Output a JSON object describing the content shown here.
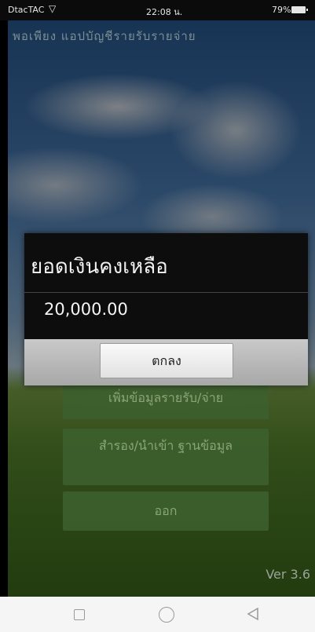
{
  "status_bar": {
    "carrier": "DtacTAC",
    "time": "22:08 น.",
    "battery": "79%"
  },
  "app": {
    "title": "พอเพียง แอปบัญชีรายรับรายจ่าย",
    "menu": [
      {
        "label": "เพิ่มข้อมูลรายรับ/จ่าย"
      },
      {
        "label": "สำรอง/นำเข้า ฐานข้อมูล"
      },
      {
        "label": "ออก"
      }
    ],
    "version": "Ver 3.6"
  },
  "dialog": {
    "title": "ยอดเงินคงเหลือ",
    "message": "20,000.00",
    "ok_label": "ตกลง"
  },
  "nav": {
    "icons": [
      "recent-apps-icon",
      "home-icon",
      "back-icon"
    ]
  }
}
